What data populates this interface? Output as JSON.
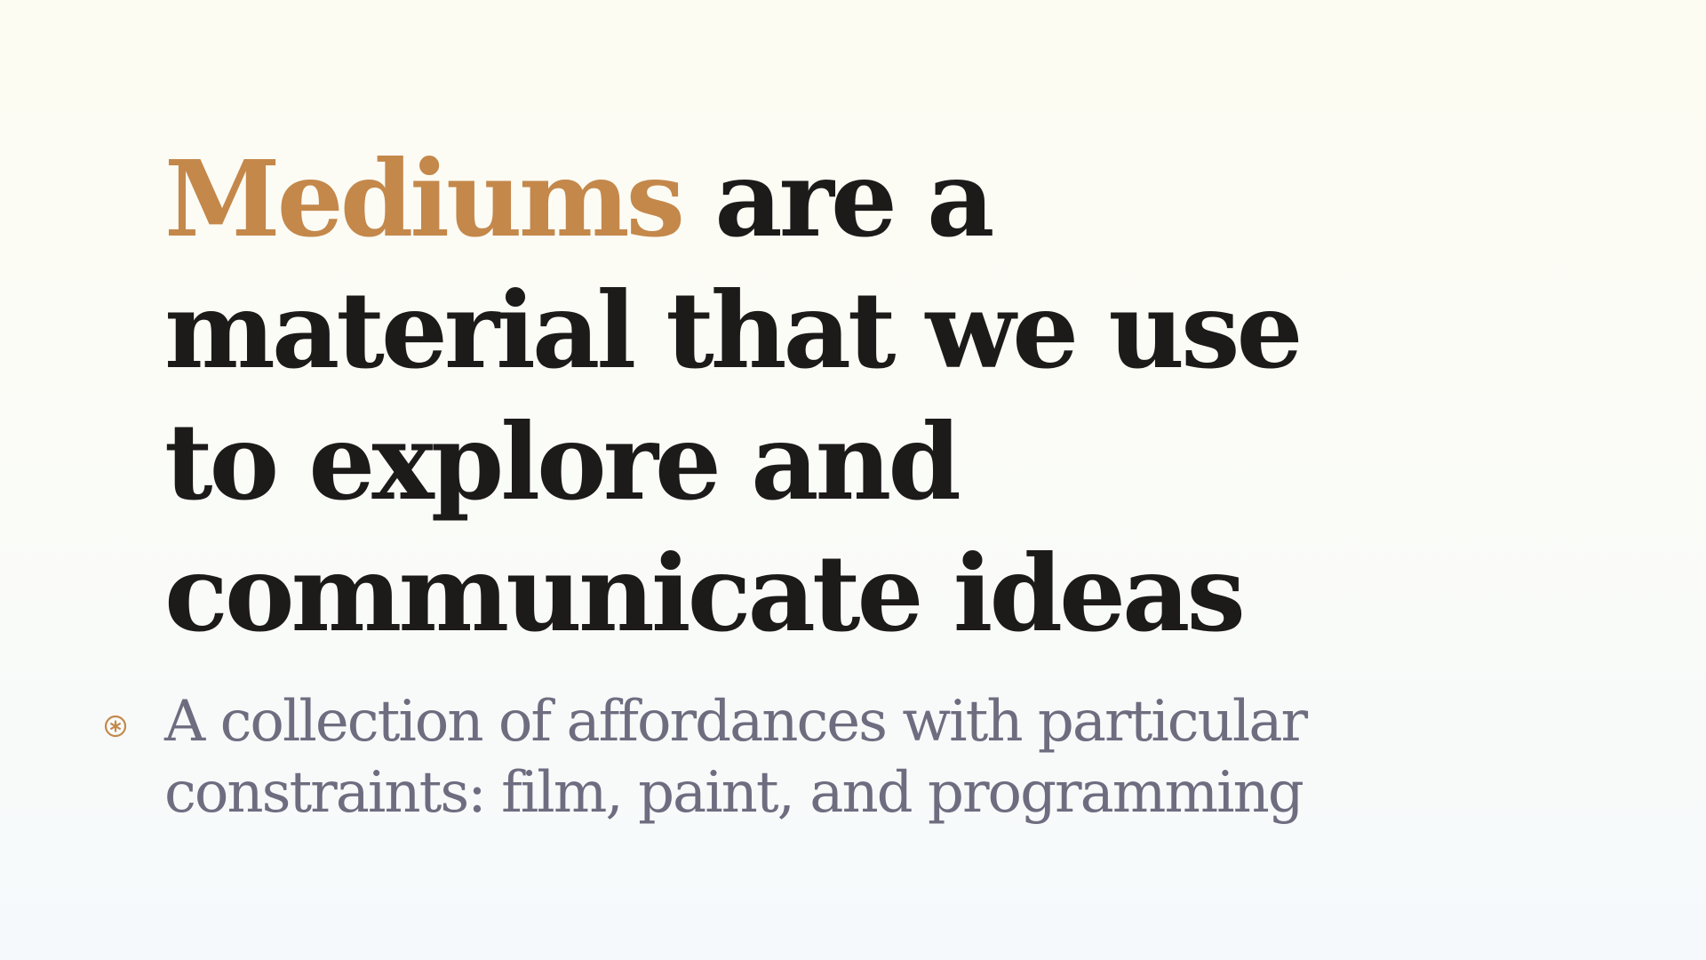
{
  "slide": {
    "headline": {
      "highlight": "Mediums",
      "line1_rest": "are a",
      "line2": "material that we use",
      "line3": "to explore and",
      "line4": "communicate ideas"
    },
    "bullet": {
      "icon": "asterisk-circle-icon",
      "line1": "A collection of affordances with particular",
      "line2": "constraints: film, paint, and programming"
    }
  },
  "colors": {
    "accent": "#c4884b",
    "headline_text": "#1d1a1a",
    "body_text": "#6e6d80",
    "background_top": "#fcfcf2",
    "background_bottom": "#f6f9fc"
  }
}
